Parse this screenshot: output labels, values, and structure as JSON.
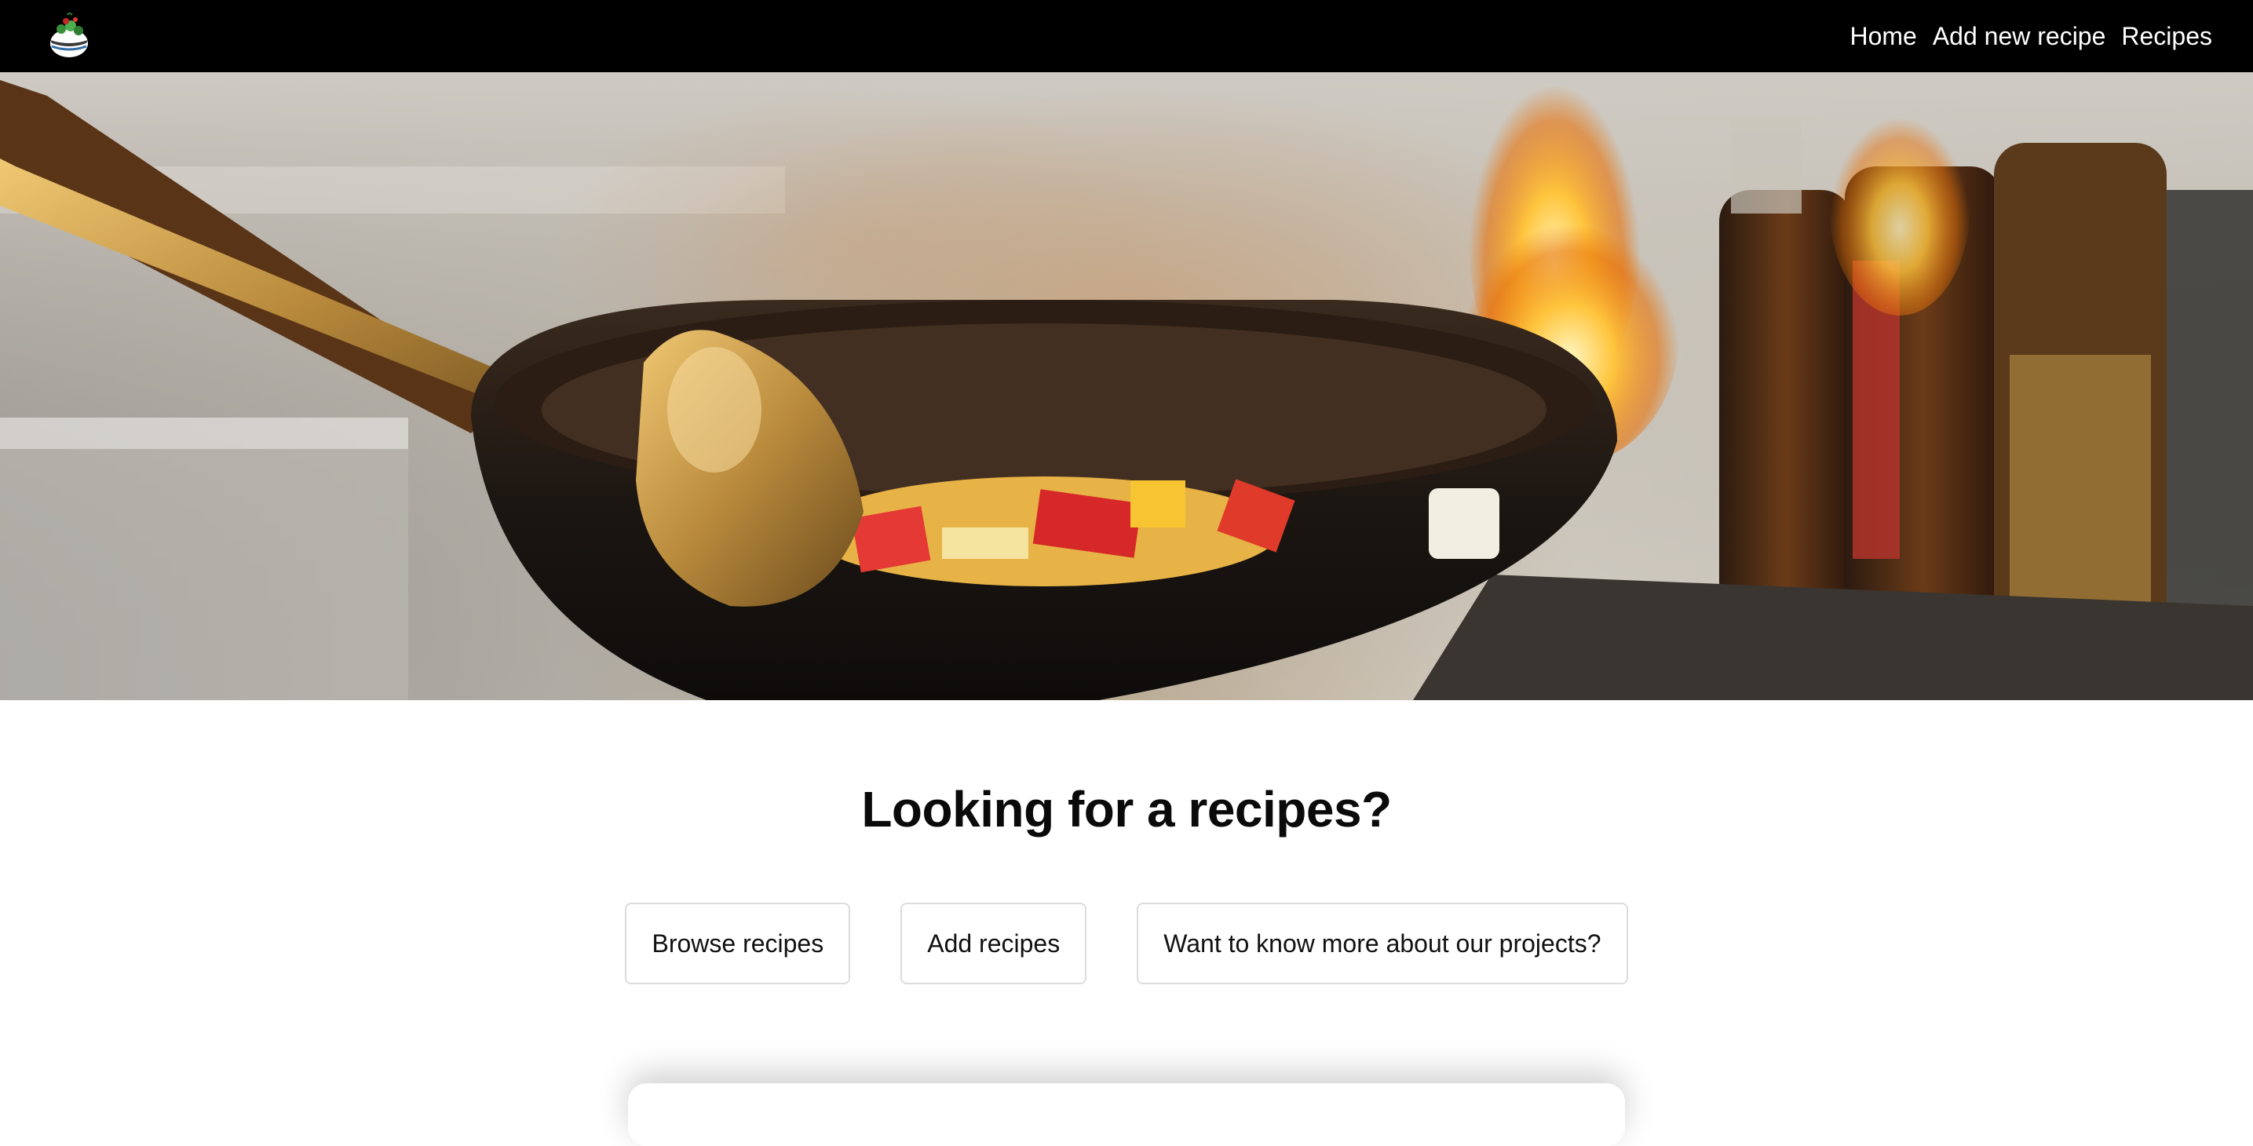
{
  "navbar": {
    "logo_icon": "salad-bowl-logo-icon",
    "links": [
      {
        "label": "Home"
      },
      {
        "label": "Add new recipe"
      },
      {
        "label": "Recipes"
      }
    ]
  },
  "hero": {
    "image": "wok-stir-fry-flames-photo"
  },
  "main": {
    "headline": "Looking for a recipes?",
    "buttons": [
      {
        "label": "Browse recipes"
      },
      {
        "label": "Add recipes"
      },
      {
        "label": "Want to know more about our projects?"
      }
    ]
  },
  "colors": {
    "navbar_bg": "#000000",
    "nav_text": "#ffffff",
    "page_bg": "#ffffff",
    "button_border": "#dcdcdc"
  }
}
